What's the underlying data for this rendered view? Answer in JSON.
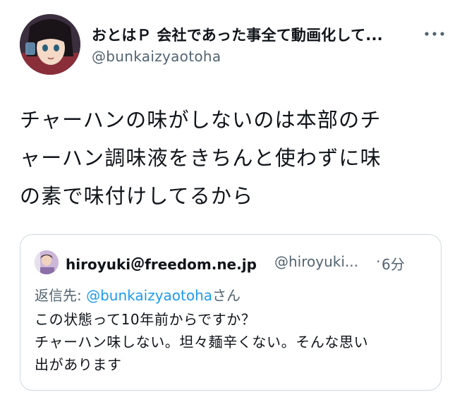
{
  "tweet": {
    "author_name": "おとはＰ 会社であった事全て動画化して...",
    "author_handle": "@bunkaizyaotoha",
    "body_lines": [
      "チャーハンの味がしないのは本部のチ",
      "ャーハン調味液をきちんと使わずに味",
      "の素で味付けしてるから"
    ],
    "more_icon": "more-horizontal-icon"
  },
  "quote": {
    "author_name": "hiroyuki＠freedom.ne.jp",
    "author_handle": "@hiroyuki...",
    "separator": "·",
    "time": "6分",
    "reply_prefix": "返信先: ",
    "reply_mention": "@bunkaizyaotoha",
    "reply_suffix": "さん",
    "text_lines": [
      "この状態って10年前からですか？",
      "チャーハン味しない。坦々麺辛くない。そんな思い",
      "出があります"
    ]
  },
  "colors": {
    "text": "#0f1419",
    "secondary": "#536471",
    "link": "#1d9bf0",
    "border": "#cfd9de"
  }
}
